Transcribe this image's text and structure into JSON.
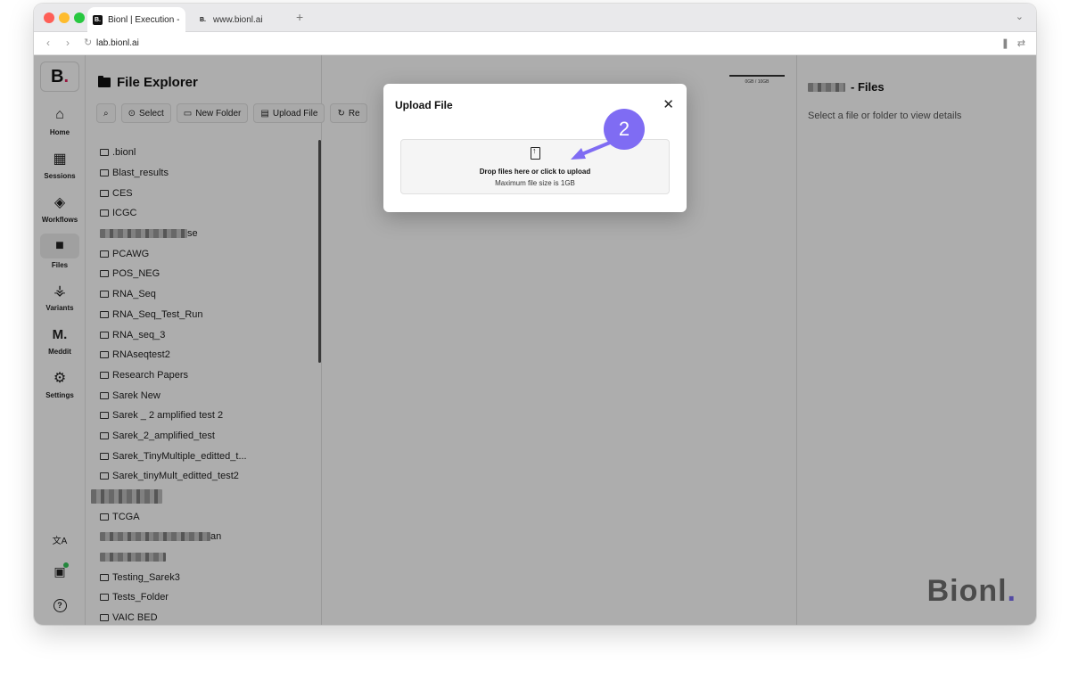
{
  "browser": {
    "active_tab_title": "Bionl | Execution - ",
    "active_tab_favicon": "B.",
    "inactive_tab_title": "www.bionl.ai",
    "inactive_tab_favicon": "B.",
    "new_tab_symbol": "+",
    "url": "lab.bionl.ai"
  },
  "sidebar": {
    "logo": "B",
    "logo_dot": ".",
    "items": [
      {
        "label": "Home",
        "icon": "home-icon",
        "glyph": "⌂"
      },
      {
        "label": "Sessions",
        "icon": "grid-icon",
        "glyph": "▦"
      },
      {
        "label": "Workflows",
        "icon": "layers-icon",
        "glyph": "◈"
      },
      {
        "label": "Files",
        "icon": "folder-icon",
        "glyph": "■"
      },
      {
        "label": "Variants",
        "icon": "dna-icon",
        "glyph": "⚶"
      },
      {
        "label": "Meddit",
        "icon": "meddit-logo-icon",
        "glyph": "M."
      },
      {
        "label": "Settings",
        "icon": "gear-icon",
        "glyph": "⚙"
      }
    ],
    "bottom": {
      "translate_glyph": "文A",
      "chip_glyph": "▣",
      "help_glyph": "?"
    }
  },
  "explorer": {
    "title": "File Explorer",
    "toolbar": {
      "search_glyph": "⌕",
      "select": "Select",
      "new_folder": "New Folder",
      "upload_file": "Upload File",
      "refresh": "Re"
    },
    "files": [
      ".bionl",
      "Blast_results",
      "CES",
      "ICGC",
      "se",
      "PCAWG",
      "POS_NEG",
      "RNA_Seq",
      "RNA_Seq_Test_Run",
      "RNA_seq_3",
      "RNAseqtest2",
      "Research Papers",
      "Sarek New",
      "Sarek _ 2 amplified test 2",
      "Sarek_2_amplified_test",
      "Sarek_TinyMultiple_editted_t...",
      "Sarek_tinyMult_editted_test2",
      "",
      "TCGA",
      "an",
      "",
      "Testing_Sarek3",
      "Tests_Folder",
      "VAIC BED"
    ],
    "storage": "0GB / 10GB"
  },
  "details": {
    "title": "- Files",
    "subtitle": "Select a file or folder to view details",
    "brand": "Bionl",
    "brand_dot": "."
  },
  "modal": {
    "title": "Upload File",
    "close_glyph": "✕",
    "drop_text": "Drop files here or click to upload",
    "drop_sub": "Maximum file size is 1GB"
  },
  "annotation": {
    "step": "2",
    "color": "#7f6cf3"
  }
}
